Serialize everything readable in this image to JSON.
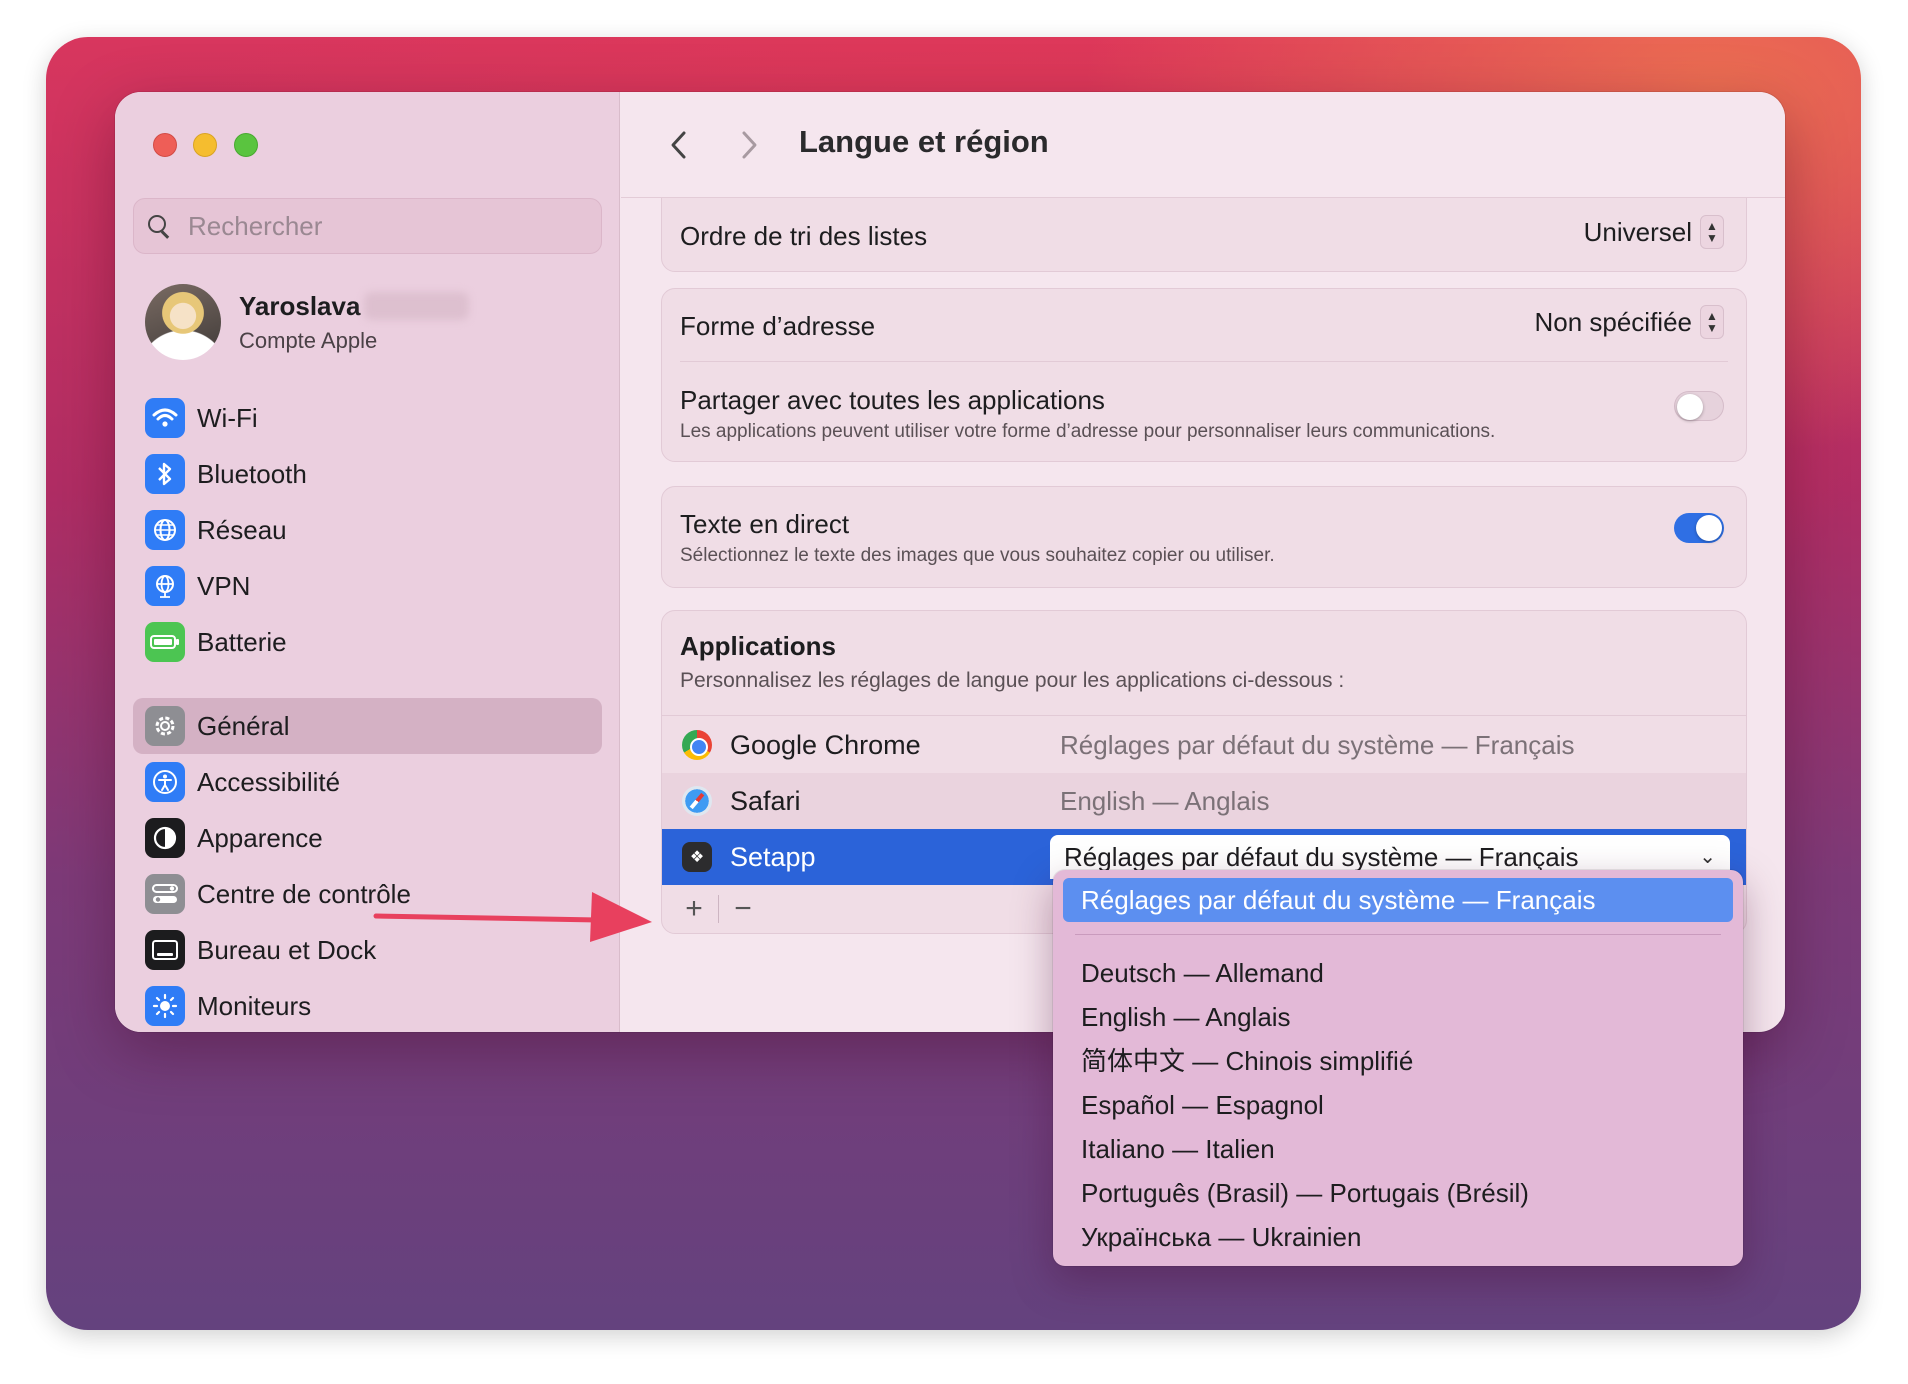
{
  "sidebar": {
    "search_placeholder": "Rechercher",
    "profile": {
      "name": "Yaroslava",
      "subtitle": "Compte Apple"
    },
    "group1": [
      {
        "label": "Wi-Fi",
        "icon": "wifi-icon",
        "color": "#2f7cf6"
      },
      {
        "label": "Bluetooth",
        "icon": "bluetooth-icon",
        "color": "#2f7cf6"
      },
      {
        "label": "Réseau",
        "icon": "globe-icon",
        "color": "#2f7cf6"
      },
      {
        "label": "VPN",
        "icon": "vpn-globe-icon",
        "color": "#2f7cf6"
      },
      {
        "label": "Batterie",
        "icon": "battery-icon",
        "color": "#4cc552"
      }
    ],
    "group2": [
      {
        "label": "Général",
        "icon": "gear-icon",
        "color": "#8e8e93",
        "selected": true
      },
      {
        "label": "Accessibilité",
        "icon": "accessibility-icon",
        "color": "#2f7cf6"
      },
      {
        "label": "Apparence",
        "icon": "appearance-icon",
        "color": "#1c1c1e"
      },
      {
        "label": "Centre de contrôle",
        "icon": "control-center-icon",
        "color": "#8e8e93"
      },
      {
        "label": "Bureau et Dock",
        "icon": "dock-icon",
        "color": "#1c1c1e"
      },
      {
        "label": "Moniteurs",
        "icon": "display-icon",
        "color": "#2f7cf6"
      }
    ]
  },
  "header": {
    "title": "Langue et région"
  },
  "settings": {
    "sort_order": {
      "label": "Ordre de tri des listes",
      "value": "Universel"
    },
    "address_form": {
      "label": "Forme d’adresse",
      "value": "Non spécifiée"
    },
    "share_all": {
      "label": "Partager avec toutes les applications",
      "description": "Les applications peuvent utiliser votre forme d’adresse pour personnaliser leurs communications.",
      "enabled": false
    },
    "live_text": {
      "label": "Texte en direct",
      "description": "Sélectionnez le texte des images que vous souhaitez copier ou utiliser.",
      "enabled": true
    }
  },
  "applications": {
    "title": "Applications",
    "description": "Personnalisez les réglages de langue pour les applications ci-dessous :",
    "rows": [
      {
        "name": "Google Chrome",
        "language": "Réglages par défaut du système — Français"
      },
      {
        "name": "Safari",
        "language": "English — Anglais"
      },
      {
        "name": "Setapp",
        "language": "Réglages par défaut du système — Français"
      }
    ],
    "add_label": "+",
    "remove_label": "−"
  },
  "language_menu": {
    "selected": "Réglages par défaut du système — Français",
    "options": [
      "Deutsch — Allemand",
      "English — Anglais",
      "简体中文 — Chinois simplifié",
      "Español — Espagnol",
      "Italiano — Italien",
      "Português (Brasil) — Portugais (Brésil)",
      "Українська — Ukrainien"
    ]
  },
  "colors": {
    "accent": "#2b63d9",
    "arrow": "#e8405e"
  }
}
